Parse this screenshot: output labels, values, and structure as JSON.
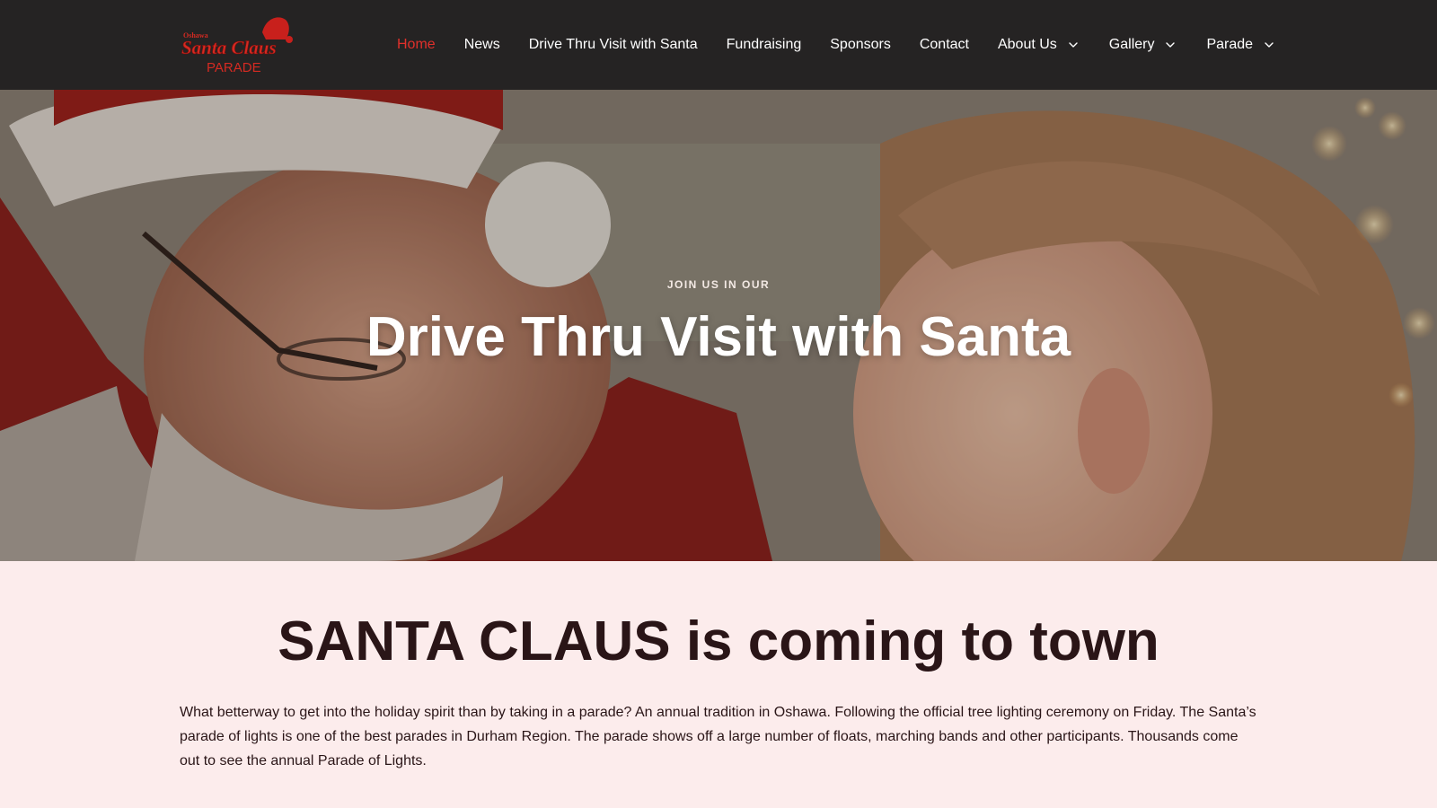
{
  "header": {
    "logo": {
      "line1": "Oshawa",
      "line2": "Santa Claus",
      "line3": "PARADE"
    },
    "nav": [
      {
        "label": "Home",
        "active": true,
        "has_dropdown": false
      },
      {
        "label": "News",
        "active": false,
        "has_dropdown": false
      },
      {
        "label": "Drive Thru Visit with Santa",
        "active": false,
        "has_dropdown": false
      },
      {
        "label": "Fundraising",
        "active": false,
        "has_dropdown": false
      },
      {
        "label": "Sponsors",
        "active": false,
        "has_dropdown": false
      },
      {
        "label": "Contact",
        "active": false,
        "has_dropdown": false
      },
      {
        "label": "About Us",
        "active": false,
        "has_dropdown": true
      },
      {
        "label": "Gallery",
        "active": false,
        "has_dropdown": true
      },
      {
        "label": "Parade",
        "active": false,
        "has_dropdown": true
      }
    ]
  },
  "hero": {
    "kicker": "JOIN US IN OUR",
    "title": "Drive Thru Visit with Santa"
  },
  "main": {
    "heading": "SANTA CLAUS is coming to town",
    "paragraph": "What betterway to get into the holiday spirit than by taking in a parade? An annual tradition in Oshawa. Following the official tree lighting ceremony on Friday. The Santa’s parade of lights is one of the best parades in Durham Region. The parade shows off a large number of floats, marching bands and other participants. Thousands come out to see the annual Parade of Lights."
  },
  "colors": {
    "header_bg": "#252323",
    "nav_active": "#e0302b",
    "page_bg": "#fcecec",
    "text_dark": "#2a1517"
  }
}
